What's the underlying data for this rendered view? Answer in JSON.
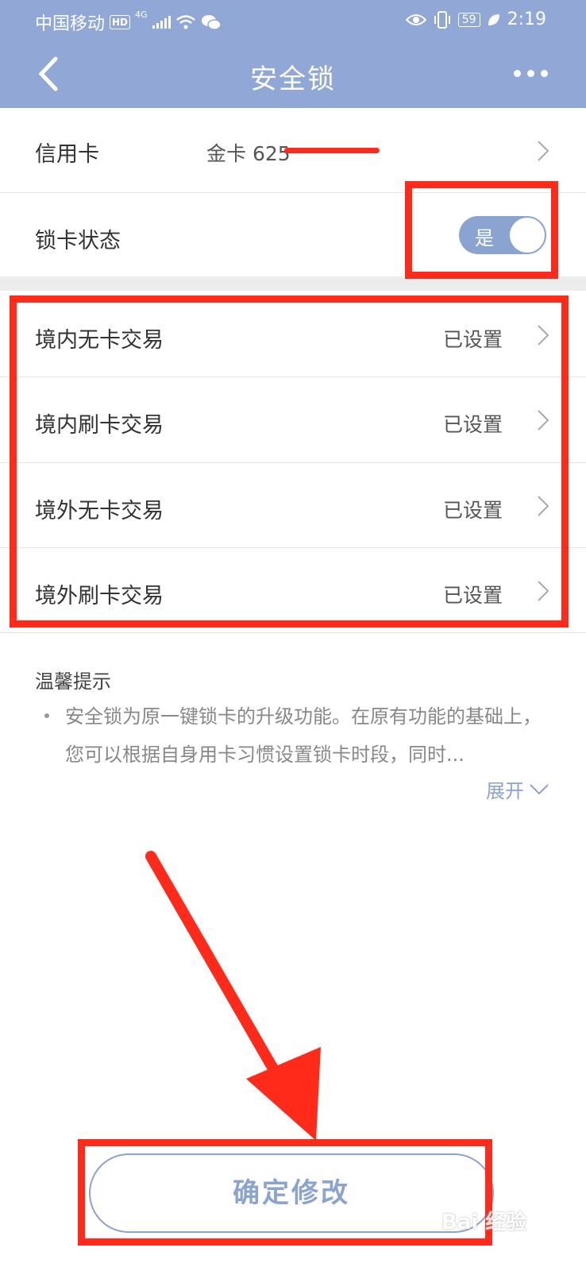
{
  "status_bar": {
    "carrier": "中国移动",
    "hd": "HD",
    "network": "4G",
    "battery": "59",
    "time": "2:19"
  },
  "nav": {
    "title": "安全锁",
    "back_icon": "chevron-left-icon",
    "more_icon": "more-dots-icon"
  },
  "card": {
    "label": "信用卡",
    "value": "金卡 625"
  },
  "lock_status": {
    "label": "锁卡状态",
    "toggle_text": "是",
    "on": true
  },
  "transactions": [
    {
      "label": "境内无卡交易",
      "status": "已设置"
    },
    {
      "label": "境内刷卡交易",
      "status": "已设置"
    },
    {
      "label": "境外无卡交易",
      "status": "已设置"
    },
    {
      "label": "境外刷卡交易",
      "status": "已设置"
    }
  ],
  "tips": {
    "title": "温馨提示",
    "text": "安全锁为原一键锁卡的升级功能。在原有功能的基础上，您可以根据自身用卡习惯设置锁卡时段，同时...",
    "expand_label": "展开"
  },
  "confirm_button": "确定修改",
  "watermark": "Bai 经验",
  "colors": {
    "header": "#91a8d6",
    "accent": "#8aa3d1",
    "annotation_red": "#ff2a1a"
  }
}
